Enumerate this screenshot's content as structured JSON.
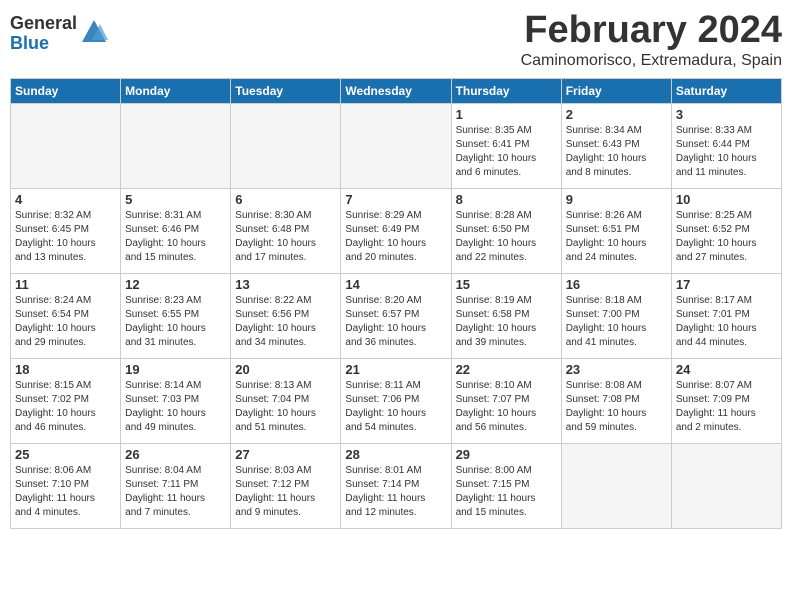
{
  "header": {
    "logo_general": "General",
    "logo_blue": "Blue",
    "title": "February 2024",
    "location": "Caminomorisco, Extremadura, Spain"
  },
  "columns": [
    "Sunday",
    "Monday",
    "Tuesday",
    "Wednesday",
    "Thursday",
    "Friday",
    "Saturday"
  ],
  "weeks": [
    [
      {
        "day": "",
        "info": ""
      },
      {
        "day": "",
        "info": ""
      },
      {
        "day": "",
        "info": ""
      },
      {
        "day": "",
        "info": ""
      },
      {
        "day": "1",
        "info": "Sunrise: 8:35 AM\nSunset: 6:41 PM\nDaylight: 10 hours\nand 6 minutes."
      },
      {
        "day": "2",
        "info": "Sunrise: 8:34 AM\nSunset: 6:43 PM\nDaylight: 10 hours\nand 8 minutes."
      },
      {
        "day": "3",
        "info": "Sunrise: 8:33 AM\nSunset: 6:44 PM\nDaylight: 10 hours\nand 11 minutes."
      }
    ],
    [
      {
        "day": "4",
        "info": "Sunrise: 8:32 AM\nSunset: 6:45 PM\nDaylight: 10 hours\nand 13 minutes."
      },
      {
        "day": "5",
        "info": "Sunrise: 8:31 AM\nSunset: 6:46 PM\nDaylight: 10 hours\nand 15 minutes."
      },
      {
        "day": "6",
        "info": "Sunrise: 8:30 AM\nSunset: 6:48 PM\nDaylight: 10 hours\nand 17 minutes."
      },
      {
        "day": "7",
        "info": "Sunrise: 8:29 AM\nSunset: 6:49 PM\nDaylight: 10 hours\nand 20 minutes."
      },
      {
        "day": "8",
        "info": "Sunrise: 8:28 AM\nSunset: 6:50 PM\nDaylight: 10 hours\nand 22 minutes."
      },
      {
        "day": "9",
        "info": "Sunrise: 8:26 AM\nSunset: 6:51 PM\nDaylight: 10 hours\nand 24 minutes."
      },
      {
        "day": "10",
        "info": "Sunrise: 8:25 AM\nSunset: 6:52 PM\nDaylight: 10 hours\nand 27 minutes."
      }
    ],
    [
      {
        "day": "11",
        "info": "Sunrise: 8:24 AM\nSunset: 6:54 PM\nDaylight: 10 hours\nand 29 minutes."
      },
      {
        "day": "12",
        "info": "Sunrise: 8:23 AM\nSunset: 6:55 PM\nDaylight: 10 hours\nand 31 minutes."
      },
      {
        "day": "13",
        "info": "Sunrise: 8:22 AM\nSunset: 6:56 PM\nDaylight: 10 hours\nand 34 minutes."
      },
      {
        "day": "14",
        "info": "Sunrise: 8:20 AM\nSunset: 6:57 PM\nDaylight: 10 hours\nand 36 minutes."
      },
      {
        "day": "15",
        "info": "Sunrise: 8:19 AM\nSunset: 6:58 PM\nDaylight: 10 hours\nand 39 minutes."
      },
      {
        "day": "16",
        "info": "Sunrise: 8:18 AM\nSunset: 7:00 PM\nDaylight: 10 hours\nand 41 minutes."
      },
      {
        "day": "17",
        "info": "Sunrise: 8:17 AM\nSunset: 7:01 PM\nDaylight: 10 hours\nand 44 minutes."
      }
    ],
    [
      {
        "day": "18",
        "info": "Sunrise: 8:15 AM\nSunset: 7:02 PM\nDaylight: 10 hours\nand 46 minutes."
      },
      {
        "day": "19",
        "info": "Sunrise: 8:14 AM\nSunset: 7:03 PM\nDaylight: 10 hours\nand 49 minutes."
      },
      {
        "day": "20",
        "info": "Sunrise: 8:13 AM\nSunset: 7:04 PM\nDaylight: 10 hours\nand 51 minutes."
      },
      {
        "day": "21",
        "info": "Sunrise: 8:11 AM\nSunset: 7:06 PM\nDaylight: 10 hours\nand 54 minutes."
      },
      {
        "day": "22",
        "info": "Sunrise: 8:10 AM\nSunset: 7:07 PM\nDaylight: 10 hours\nand 56 minutes."
      },
      {
        "day": "23",
        "info": "Sunrise: 8:08 AM\nSunset: 7:08 PM\nDaylight: 10 hours\nand 59 minutes."
      },
      {
        "day": "24",
        "info": "Sunrise: 8:07 AM\nSunset: 7:09 PM\nDaylight: 11 hours\nand 2 minutes."
      }
    ],
    [
      {
        "day": "25",
        "info": "Sunrise: 8:06 AM\nSunset: 7:10 PM\nDaylight: 11 hours\nand 4 minutes."
      },
      {
        "day": "26",
        "info": "Sunrise: 8:04 AM\nSunset: 7:11 PM\nDaylight: 11 hours\nand 7 minutes."
      },
      {
        "day": "27",
        "info": "Sunrise: 8:03 AM\nSunset: 7:12 PM\nDaylight: 11 hours\nand 9 minutes."
      },
      {
        "day": "28",
        "info": "Sunrise: 8:01 AM\nSunset: 7:14 PM\nDaylight: 11 hours\nand 12 minutes."
      },
      {
        "day": "29",
        "info": "Sunrise: 8:00 AM\nSunset: 7:15 PM\nDaylight: 11 hours\nand 15 minutes."
      },
      {
        "day": "",
        "info": ""
      },
      {
        "day": "",
        "info": ""
      }
    ]
  ]
}
